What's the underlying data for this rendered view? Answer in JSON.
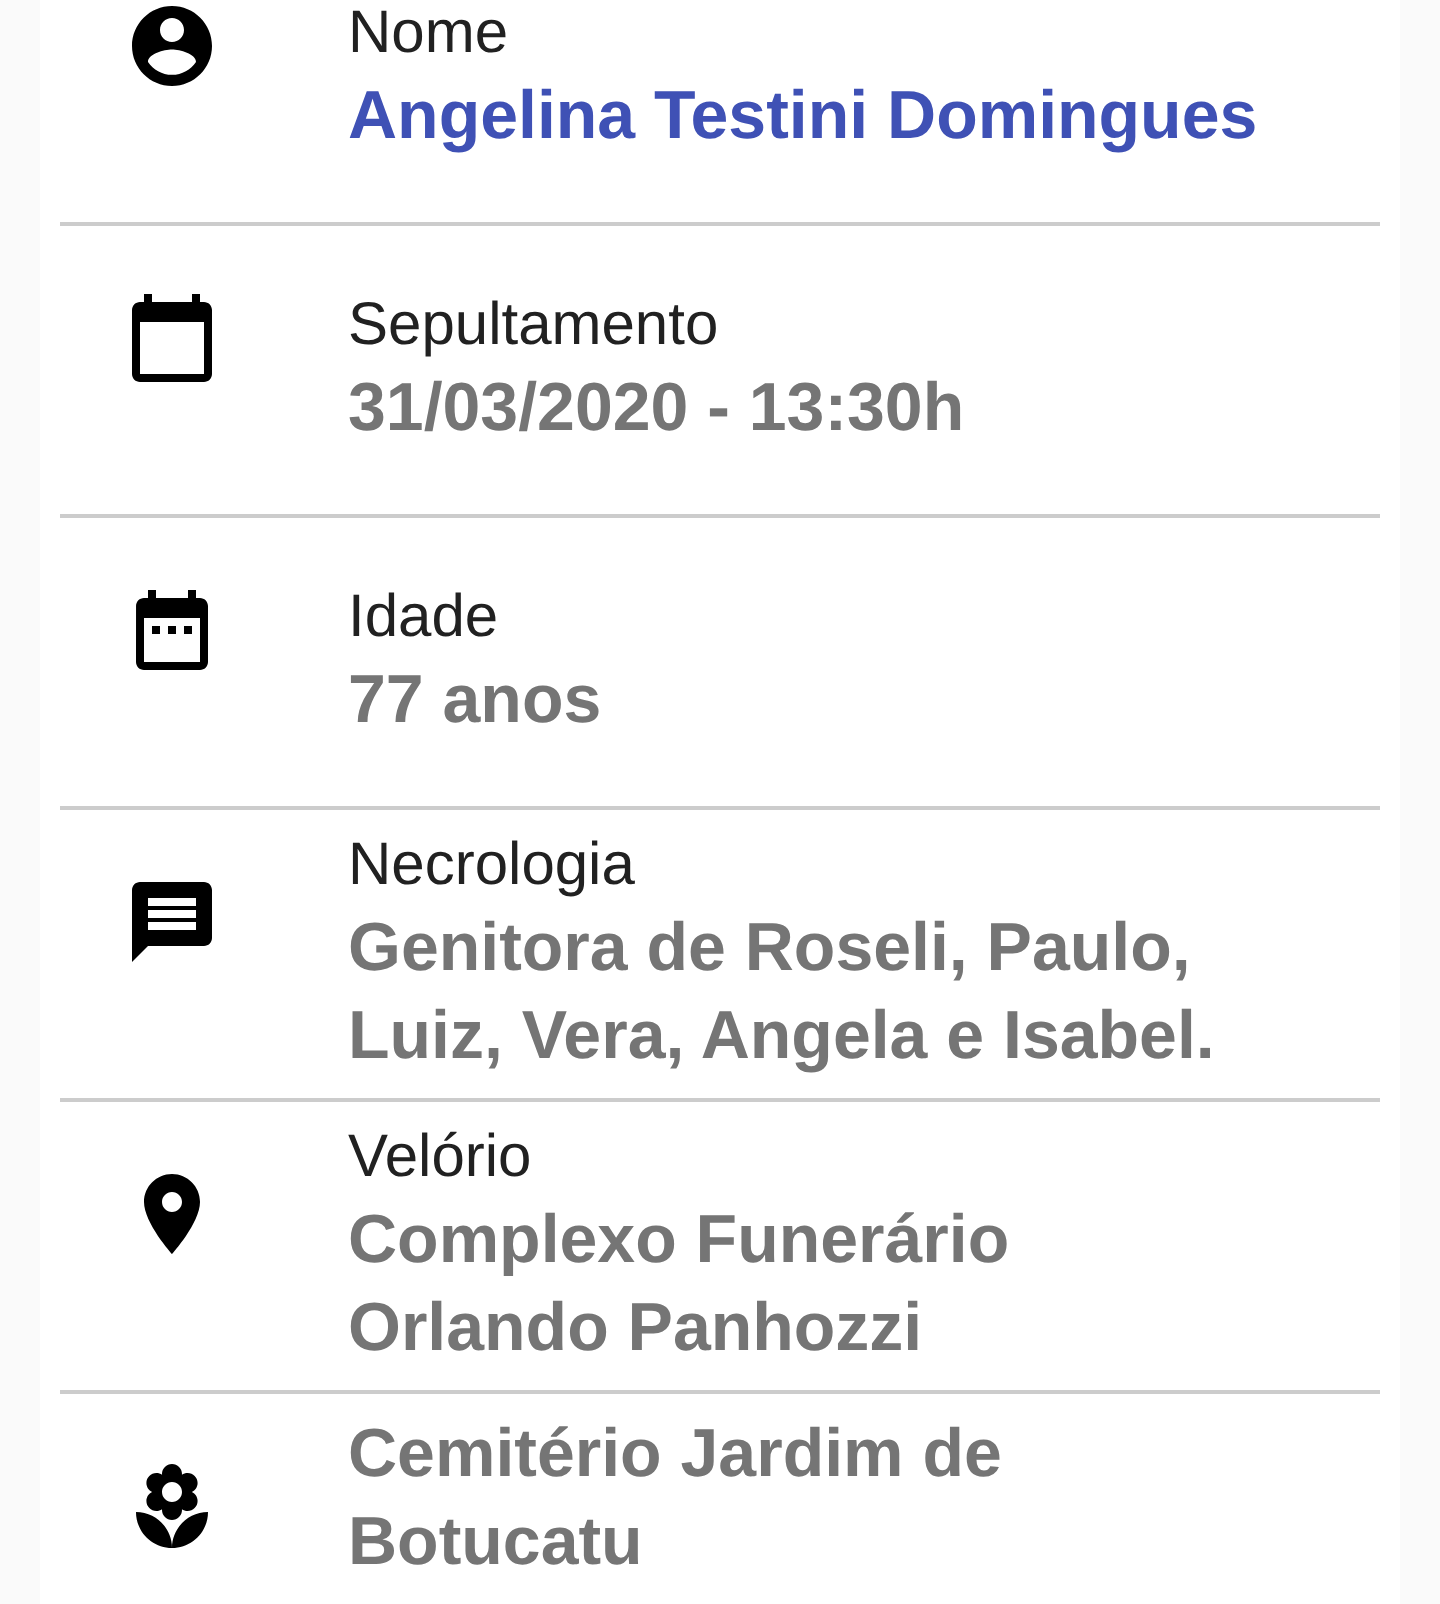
{
  "fields": [
    {
      "kind": "person",
      "label": "Nome",
      "value": "Angelina Testini Domingues"
    },
    {
      "kind": "burial",
      "label": "Sepultamento",
      "value": "31/03/2020 - 13:30h"
    },
    {
      "kind": "age",
      "label": "Idade",
      "value": "77 anos"
    },
    {
      "kind": "obituary",
      "label": "Necrologia",
      "value": "Genitora de Roseli, Paulo, Luiz, Vera, Angela e Isabel."
    },
    {
      "kind": "wake",
      "label": "Velório",
      "value": "Complexo Funerário Orlando Panhozzi"
    },
    {
      "kind": "cemetery",
      "value": "Cemitério Jardim de Botucatu"
    }
  ]
}
